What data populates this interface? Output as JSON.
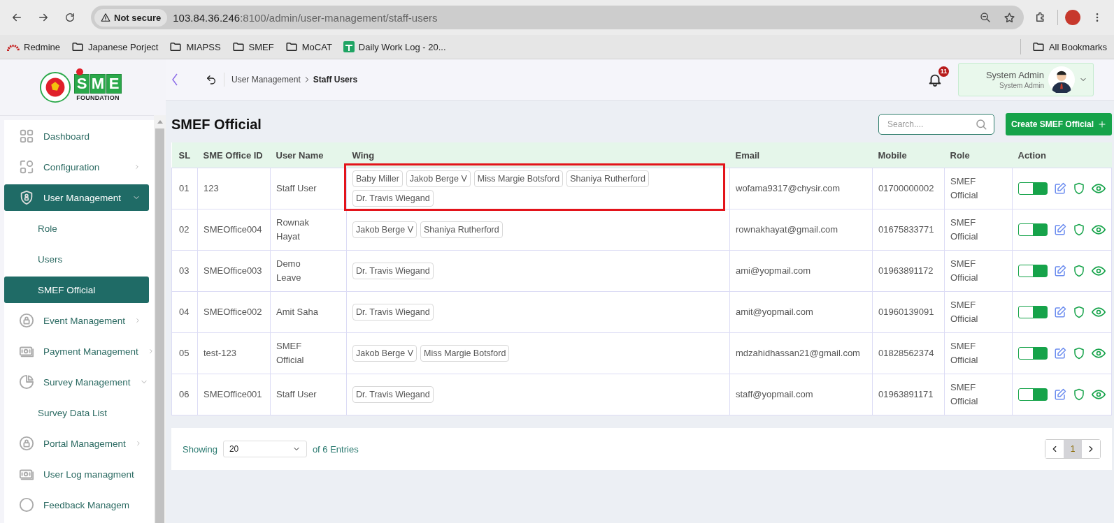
{
  "browser": {
    "security": "Not secure",
    "url_host": "103.84.36.246",
    "url_path": ":8100/admin/user-management/staff-users",
    "bookmarks": [
      {
        "label": "Redmine",
        "kind": "redmine"
      },
      {
        "label": "Japanese Porject",
        "kind": "folder"
      },
      {
        "label": "MIAPSS",
        "kind": "folder"
      },
      {
        "label": "SMEF",
        "kind": "folder"
      },
      {
        "label": "MoCAT",
        "kind": "folder"
      },
      {
        "label": "Daily Work Log - 20...",
        "kind": "sheet"
      }
    ],
    "all_bookmarks": "All Bookmarks"
  },
  "logo": {
    "letters": "SME",
    "subtitle": "FOUNDATION"
  },
  "sidebar": {
    "items": [
      {
        "label": "Dashboard",
        "selected": false
      },
      {
        "label": "Configuration",
        "selected": false,
        "expanded": false
      },
      {
        "label": "User Management",
        "selected": true,
        "expanded": true,
        "children": [
          {
            "label": "Role",
            "selected": false
          },
          {
            "label": "Users",
            "selected": false
          },
          {
            "label": "SMEF Official",
            "selected": true
          }
        ]
      },
      {
        "label": "Event Management",
        "selected": false,
        "expanded": false
      },
      {
        "label": "Payment Management",
        "selected": false,
        "expanded": false
      },
      {
        "label": "Survey Management",
        "selected": false,
        "expanded": true,
        "children": [
          {
            "label": "Survey Data List",
            "selected": false
          }
        ]
      },
      {
        "label": "Portal Management",
        "selected": false,
        "expanded": false
      },
      {
        "label": "User Log managment",
        "selected": false
      },
      {
        "label": "Feedback Managem",
        "selected": false
      }
    ]
  },
  "header": {
    "breadcrumb": [
      "User Management",
      "Staff Users"
    ],
    "notification_count": "11",
    "user": {
      "name": "System Admin",
      "role": "System Admin"
    }
  },
  "page": {
    "title": "SMEF Official",
    "search": {
      "placeholder": "Search...."
    },
    "create_button": "Create SMEF Official"
  },
  "table": {
    "columns": [
      "SL",
      "SME Office ID",
      "User Name",
      "Wing",
      "Email",
      "Mobile",
      "Role",
      "Action"
    ],
    "rows": [
      {
        "sl": "01",
        "office_id": "123",
        "user_name": "Staff User",
        "wings": [
          "Baby Miller",
          "Jakob Berge V",
          "Miss Margie Botsford",
          "Shaniya Rutherford",
          "Dr. Travis Wiegand"
        ],
        "email": "wofama9317@chysir.com",
        "mobile": "01700000002",
        "role": "SMEF Official",
        "active": true,
        "highlighted": true
      },
      {
        "sl": "02",
        "office_id": "SMEOffice004",
        "user_name": "Rownak Hayat",
        "wings": [
          "Jakob Berge V",
          "Shaniya Rutherford"
        ],
        "email": "rownakhayat@gmail.com",
        "mobile": "01675833771",
        "role": "SMEF Official",
        "active": true,
        "highlighted": false
      },
      {
        "sl": "03",
        "office_id": "SMEOffice003",
        "user_name": "Demo Leave",
        "wings": [
          "Dr. Travis Wiegand"
        ],
        "email": "ami@yopmail.com",
        "mobile": "01963891172",
        "role": "SMEF Official",
        "active": true,
        "highlighted": false
      },
      {
        "sl": "04",
        "office_id": "SMEOffice002",
        "user_name": "Amit Saha",
        "wings": [
          "Dr. Travis Wiegand"
        ],
        "email": "amit@yopmail.com",
        "mobile": "01960139091",
        "role": "SMEF Official",
        "active": true,
        "highlighted": false
      },
      {
        "sl": "05",
        "office_id": "test-123",
        "user_name": "SMEF Official",
        "wings": [
          "Jakob Berge V",
          "Miss Margie Botsford"
        ],
        "email": "mdzahidhassan21@gmail.com",
        "mobile": "01828562374",
        "role": "SMEF Official",
        "active": true,
        "highlighted": false
      },
      {
        "sl": "06",
        "office_id": "SMEOffice001",
        "user_name": "Staff User",
        "wings": [
          "Dr. Travis Wiegand"
        ],
        "email": "staff@yopmail.com",
        "mobile": "01963891171",
        "role": "SMEF Official",
        "active": true,
        "highlighted": false
      }
    ]
  },
  "pagination": {
    "showing": "Showing",
    "page_size": "20",
    "entries": "of 6 Entries",
    "pages": [
      {
        "label": "1",
        "selected": true
      }
    ]
  }
}
